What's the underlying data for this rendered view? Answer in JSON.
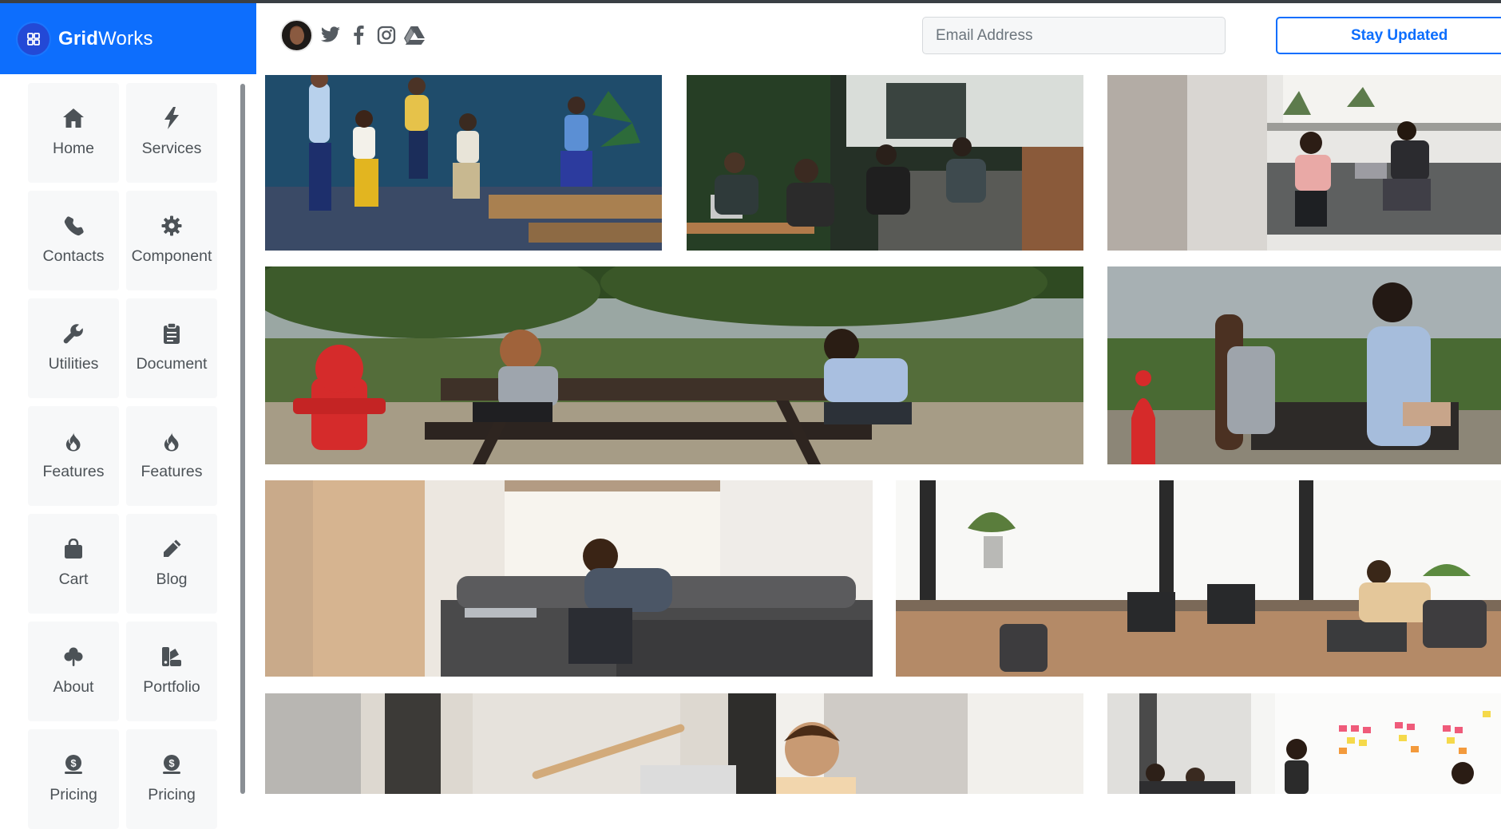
{
  "brand": {
    "name_bold": "Grid",
    "name_light": "Works",
    "logo_icon": "grid-icon"
  },
  "header": {
    "avatar": "user-avatar",
    "social": [
      {
        "name": "twitter-icon"
      },
      {
        "name": "facebook-icon"
      },
      {
        "name": "instagram-icon"
      },
      {
        "name": "google-drive-icon"
      }
    ],
    "email_placeholder": "Email Address",
    "subscribe_label": "Stay Updated"
  },
  "sidebar": {
    "items": [
      {
        "label": "Home",
        "icon": "home-icon"
      },
      {
        "label": "Services",
        "icon": "bolt-icon"
      },
      {
        "label": "Contacts",
        "icon": "phone-icon"
      },
      {
        "label": "Component",
        "icon": "gear-icon"
      },
      {
        "label": "Utilities",
        "icon": "wrench-icon"
      },
      {
        "label": "Document",
        "icon": "clipboard-icon"
      },
      {
        "label": "Features",
        "icon": "fire-icon"
      },
      {
        "label": "Features",
        "icon": "fire-icon"
      },
      {
        "label": "Cart",
        "icon": "bag-icon"
      },
      {
        "label": "Blog",
        "icon": "pencil-icon"
      },
      {
        "label": "About",
        "icon": "clover-icon"
      },
      {
        "label": "Portfolio",
        "icon": "swatches-icon"
      },
      {
        "label": "Pricing",
        "icon": "coin-icon"
      },
      {
        "label": "Pricing",
        "icon": "coin-icon"
      }
    ]
  },
  "gallery": [
    {
      "subject": "team-meeting-lounge-photo"
    },
    {
      "subject": "cafe-group-photo"
    },
    {
      "subject": "office-sofa-photo"
    },
    {
      "subject": "park-bench-meeting-photo"
    },
    {
      "subject": "park-bench-closeup-photo"
    },
    {
      "subject": "man-laptop-sofa-photo"
    },
    {
      "subject": "open-office-desk-photo"
    },
    {
      "subject": "man-desk-smiling-photo"
    },
    {
      "subject": "whiteboard-sticky-notes-photo"
    }
  ],
  "colors": {
    "brand_blue": "#0d6efd",
    "topline": "#3a3f44",
    "tile_bg": "#f7f8f9",
    "icon_gray": "#4c5257"
  }
}
